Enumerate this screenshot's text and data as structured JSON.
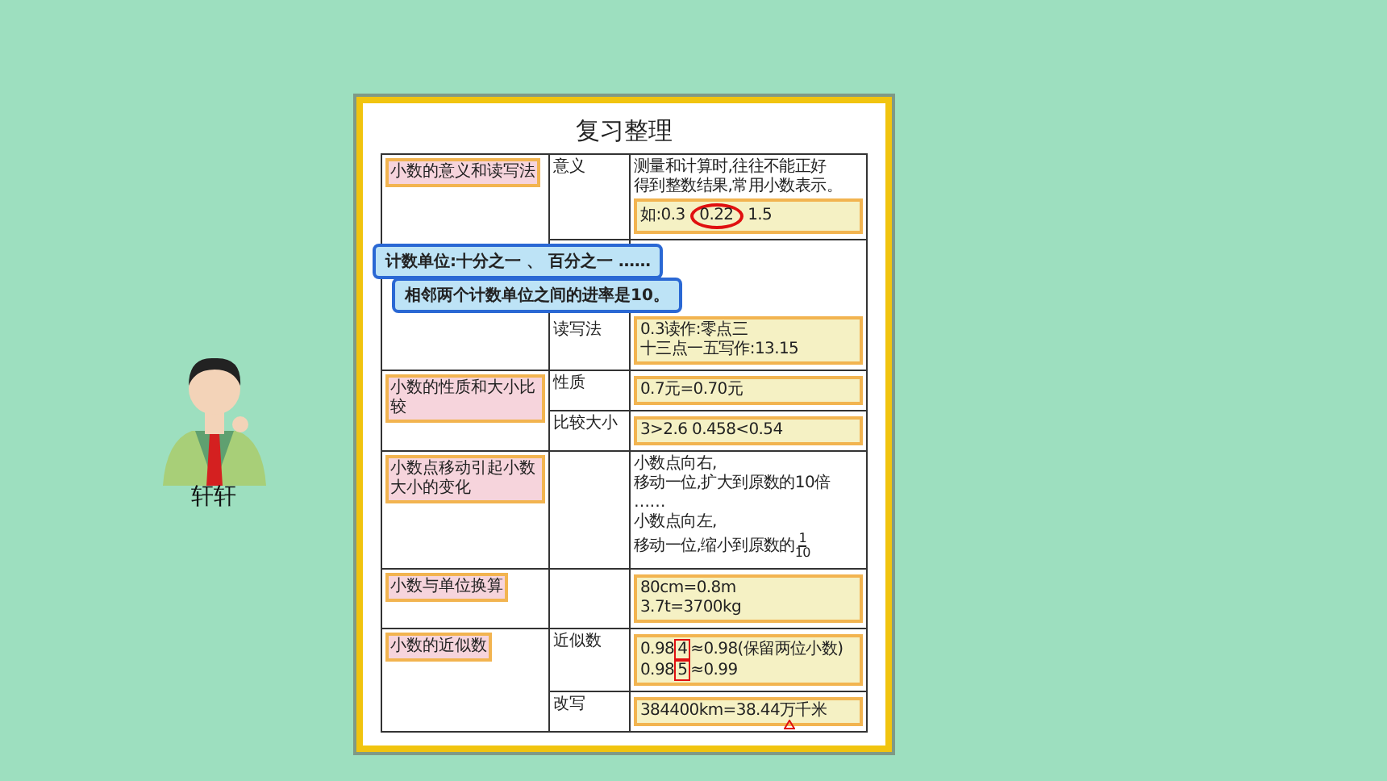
{
  "character": {
    "name": "轩轩"
  },
  "sheet": {
    "title": "复习整理",
    "rows": [
      {
        "topic": "小数的意义和读写法",
        "parts": [
          {
            "term": "意义",
            "blocks": [
              {
                "kind": "plain",
                "lines": [
                  [
                    {
                      "text": "测量和计算时,往往不能正好"
                    }
                  ],
                  [
                    {
                      "text": "得到整数结果,常用小数表示。"
                    }
                  ]
                ]
              },
              {
                "kind": "highlight",
                "lines": [
                  [
                    {
                      "text": "如:0.3 "
                    },
                    {
                      "text": "0.22",
                      "circled": true
                    },
                    {
                      "text": " 1.5"
                    }
                  ]
                ]
              }
            ]
          },
          {
            "term": "读写法",
            "blocks": [
              {
                "kind": "highlight",
                "lines": [
                  [
                    {
                      "text": "0.3读作:零点三"
                    }
                  ],
                  [
                    {
                      "text": "十三点一五写作:13.15"
                    }
                  ]
                ]
              }
            ]
          }
        ]
      },
      {
        "topic": "小数的性质和大小比较",
        "parts": [
          {
            "term": "性质",
            "blocks": [
              {
                "kind": "highlight",
                "lines": [
                  [
                    {
                      "text": "0.7元=0.70元"
                    }
                  ]
                ]
              }
            ]
          },
          {
            "term": "比较大小",
            "blocks": [
              {
                "kind": "highlight",
                "lines": [
                  [
                    {
                      "text": "3>2.6  0.458<0.54"
                    }
                  ]
                ]
              }
            ]
          }
        ]
      },
      {
        "topic": "小数点移动引起小数大小的变化",
        "parts": [
          {
            "blocks": [
              {
                "kind": "plain",
                "lines": [
                  [
                    {
                      "text": "小数点向右,"
                    }
                  ],
                  [
                    {
                      "text": "移动一位,扩大到原数的10倍"
                    }
                  ],
                  [
                    {
                      "text": "……"
                    }
                  ],
                  [
                    {
                      "text": "小数点向左,"
                    }
                  ],
                  [
                    {
                      "text": "移动一位,缩小到原数的"
                    },
                    {
                      "num": "1",
                      "den": "10"
                    }
                  ]
                ]
              }
            ]
          }
        ]
      },
      {
        "topic": "小数与单位换算",
        "parts": [
          {
            "blocks": [
              {
                "kind": "highlight",
                "lines": [
                  [
                    {
                      "text": "80cm=0.8m"
                    }
                  ],
                  [
                    {
                      "text": "3.7t=3700kg"
                    }
                  ]
                ]
              }
            ]
          }
        ]
      },
      {
        "topic": "小数的近似数",
        "parts": [
          {
            "term": "近似数",
            "blocks": [
              {
                "kind": "highlight",
                "lines": [
                  [
                    {
                      "text": "0.98"
                    },
                    {
                      "text": "4",
                      "boxed": true
                    },
                    {
                      "text": "≈0.98(保留两位小数)"
                    }
                  ],
                  [
                    {
                      "text": "0.98"
                    },
                    {
                      "text": "5",
                      "boxed": true
                    },
                    {
                      "text": "≈0.99"
                    }
                  ]
                ]
              }
            ]
          },
          {
            "term": "改写",
            "blocks": [
              {
                "kind": "highlight",
                "lines": [
                  [
                    {
                      "text": "384400km=38.44"
                    },
                    {
                      "text": "万",
                      "triangle_mark": true
                    },
                    {
                      "text": "千米"
                    }
                  ]
                ]
              }
            ]
          }
        ]
      }
    ],
    "callouts": [
      {
        "text": "计数单位:十分之一 、 百分之一 ……"
      },
      {
        "text": "相邻两个计数单位之间的进率是10。"
      }
    ]
  }
}
